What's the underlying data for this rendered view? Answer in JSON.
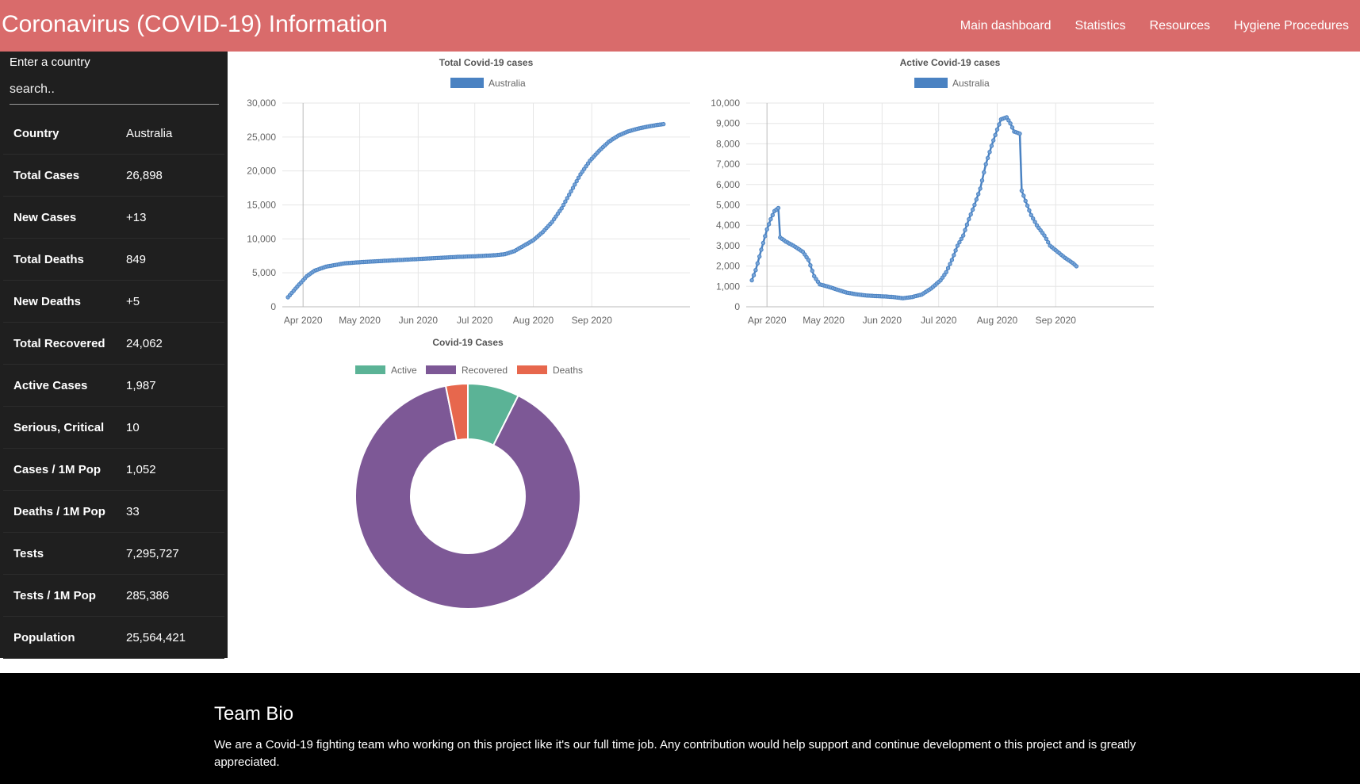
{
  "header": {
    "title": "Coronavirus (COVID-19) Information",
    "nav": [
      "Main dashboard",
      "Statistics",
      "Resources",
      "Hygiene Procedures"
    ]
  },
  "sidebar": {
    "search_label": "Enter a country",
    "search_placeholder": "search..",
    "stats": [
      {
        "label": "Country",
        "value": "Australia"
      },
      {
        "label": "Total Cases",
        "value": "26,898"
      },
      {
        "label": "New Cases",
        "value": "+13"
      },
      {
        "label": "Total Deaths",
        "value": "849"
      },
      {
        "label": "New Deaths",
        "value": "+5"
      },
      {
        "label": "Total Recovered",
        "value": "24,062"
      },
      {
        "label": "Active Cases",
        "value": "1,987"
      },
      {
        "label": "Serious, Critical",
        "value": "10"
      },
      {
        "label": "Cases / 1M Pop",
        "value": "1,052"
      },
      {
        "label": "Deaths / 1M Pop",
        "value": "33"
      },
      {
        "label": "Tests",
        "value": "7,295,727"
      },
      {
        "label": "Tests / 1M Pop",
        "value": "285,386"
      },
      {
        "label": "Population",
        "value": "25,564,421"
      }
    ]
  },
  "footer": {
    "title": "Team Bio",
    "text": "We are a Covid-19 fighting team who working on this project like it's our full time job. Any contribution would help support and continue development o this project and is greatly appreciated."
  },
  "colors": {
    "navbar": "#d96b6b",
    "sidebar": "#1f1f1f",
    "line": "#4a82c2",
    "active": "#5bb396",
    "recovered": "#7d5896",
    "deaths": "#e7674d"
  },
  "chart_data": [
    {
      "type": "line",
      "title": "Total Covid-19 cases",
      "series": [
        {
          "name": "Australia",
          "values": [
            [
              0,
              1400
            ],
            [
              5,
              3000
            ],
            [
              10,
              4500
            ],
            [
              14,
              5300
            ],
            [
              20,
              5900
            ],
            [
              30,
              6400
            ],
            [
              40,
              6600
            ],
            [
              50,
              6750
            ],
            [
              60,
              6900
            ],
            [
              70,
              7050
            ],
            [
              80,
              7200
            ],
            [
              90,
              7350
            ],
            [
              100,
              7450
            ],
            [
              110,
              7600
            ],
            [
              115,
              7750
            ],
            [
              120,
              8200
            ],
            [
              125,
              9000
            ],
            [
              130,
              9800
            ],
            [
              135,
              11000
            ],
            [
              140,
              12500
            ],
            [
              145,
              14500
            ],
            [
              150,
              17000
            ],
            [
              155,
              19500
            ],
            [
              160,
              21500
            ],
            [
              165,
              23000
            ],
            [
              170,
              24300
            ],
            [
              175,
              25200
            ],
            [
              180,
              25800
            ],
            [
              185,
              26200
            ],
            [
              190,
              26500
            ],
            [
              195,
              26750
            ],
            [
              199,
              26898
            ]
          ]
        }
      ],
      "x_ticks": [
        "Apr 2020",
        "May 2020",
        "Jun 2020",
        "Jul 2020",
        "Aug 2020",
        "Sep 2020"
      ],
      "x_tick_days": [
        8,
        38,
        69,
        99,
        130,
        161
      ],
      "ylim": [
        0,
        30000
      ],
      "y_ticks": [
        "0",
        "5,000",
        "10,000",
        "15,000",
        "20,000",
        "25,000",
        "30,000"
      ],
      "legend": "top"
    },
    {
      "type": "line",
      "title": "Active Covid-19 cases",
      "series": [
        {
          "name": "Australia",
          "values": [
            [
              0,
              1300
            ],
            [
              2,
              1800
            ],
            [
              5,
              2800
            ],
            [
              8,
              3800
            ],
            [
              10,
              4300
            ],
            [
              12,
              4700
            ],
            [
              14,
              4850
            ],
            [
              15,
              3400
            ],
            [
              18,
              3200
            ],
            [
              22,
              3000
            ],
            [
              27,
              2700
            ],
            [
              30,
              2300
            ],
            [
              33,
              1500
            ],
            [
              36,
              1100
            ],
            [
              40,
              1000
            ],
            [
              45,
              850
            ],
            [
              50,
              700
            ],
            [
              55,
              620
            ],
            [
              60,
              560
            ],
            [
              65,
              530
            ],
            [
              70,
              510
            ],
            [
              75,
              480
            ],
            [
              80,
              420
            ],
            [
              85,
              480
            ],
            [
              90,
              600
            ],
            [
              95,
              900
            ],
            [
              100,
              1300
            ],
            [
              103,
              1700
            ],
            [
              106,
              2300
            ],
            [
              109,
              3000
            ],
            [
              112,
              3500
            ],
            [
              115,
              4300
            ],
            [
              118,
              5000
            ],
            [
              121,
              5800
            ],
            [
              124,
              7000
            ],
            [
              127,
              7900
            ],
            [
              130,
              8700
            ],
            [
              132,
              9200
            ],
            [
              135,
              9300
            ],
            [
              137,
              9000
            ],
            [
              139,
              8600
            ],
            [
              142,
              8500
            ],
            [
              143,
              5700
            ],
            [
              145,
              5200
            ],
            [
              148,
              4500
            ],
            [
              151,
              4000
            ],
            [
              155,
              3500
            ],
            [
              158,
              3000
            ],
            [
              162,
              2700
            ],
            [
              166,
              2400
            ],
            [
              170,
              2150
            ],
            [
              172,
              1987
            ]
          ]
        }
      ],
      "x_ticks": [
        "Apr 2020",
        "May 2020",
        "Jun 2020",
        "Jul 2020",
        "Aug 2020",
        "Sep 2020"
      ],
      "x_tick_days": [
        8,
        38,
        69,
        99,
        130,
        161
      ],
      "ylim": [
        0,
        10000
      ],
      "y_ticks": [
        "0",
        "1,000",
        "2,000",
        "3,000",
        "4,000",
        "5,000",
        "6,000",
        "7,000",
        "8,000",
        "9,000",
        "10,000"
      ],
      "legend": "top"
    },
    {
      "type": "pie",
      "title": "Covid-19 Cases",
      "categories": [
        "Active",
        "Recovered",
        "Deaths"
      ],
      "values": [
        1987,
        24062,
        849
      ],
      "legend": "top"
    }
  ]
}
